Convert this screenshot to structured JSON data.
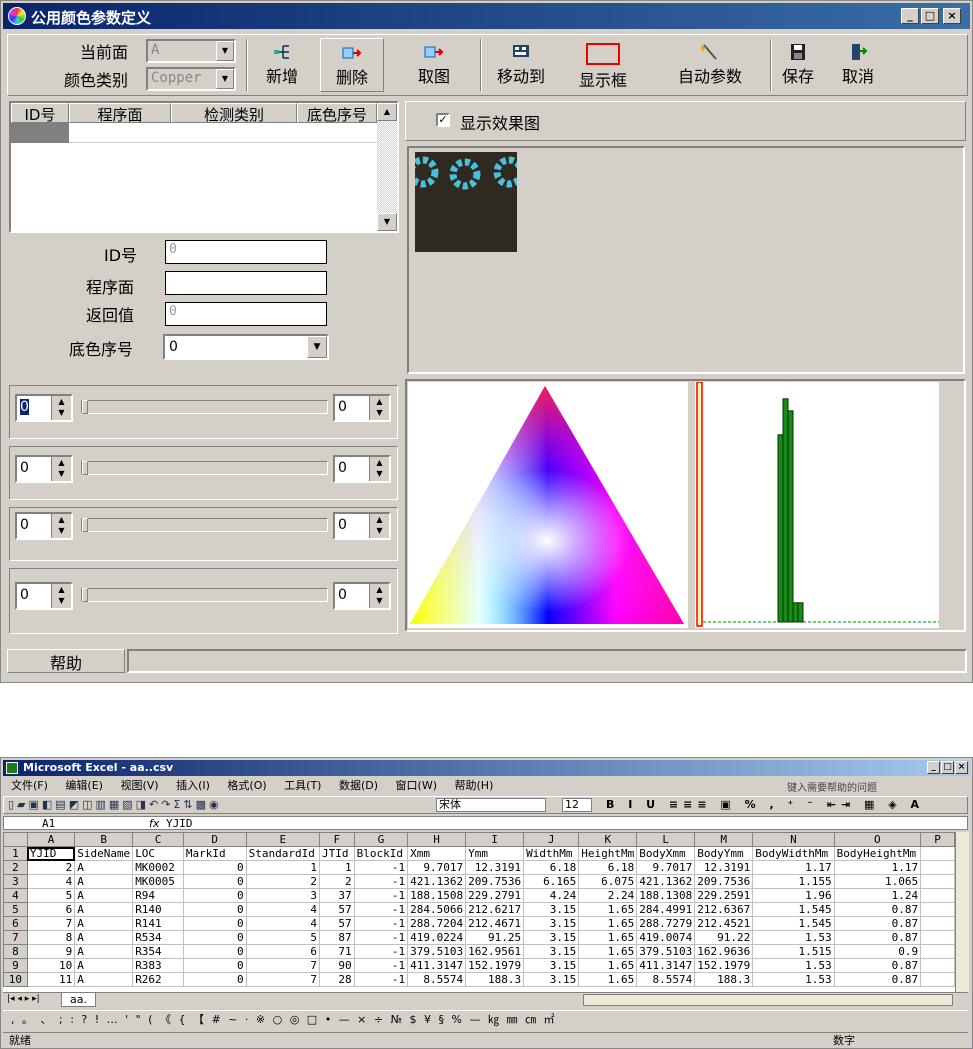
{
  "window": {
    "title": "公用颜色参数定义",
    "min": "_",
    "max": "□",
    "close": "×"
  },
  "toolbar": {
    "current_face_label": "当前面",
    "current_face_value": "A",
    "color_category_label": "颜色类别",
    "color_category_value": "Copper",
    "buttons": [
      "新增",
      "删除",
      "取图",
      "移动到",
      "显示框",
      "自动参数",
      "保存",
      "取消"
    ]
  },
  "table": {
    "headers": [
      "ID号",
      "程序面",
      "检测类别",
      "底色序号"
    ]
  },
  "form": {
    "id_label": "ID号",
    "id_value": "0",
    "program_face_label": "程序面",
    "program_face_value": "",
    "return_label": "返回值",
    "return_value": "0",
    "base_color_label": "底色序号",
    "base_color_value": "0"
  },
  "preview": {
    "checkbox_label": "显示效果图",
    "checked": true
  },
  "sliders": [
    {
      "left": "0",
      "right": "0"
    },
    {
      "left": "0",
      "right": "0"
    },
    {
      "left": "0",
      "right": "0"
    },
    {
      "left": "0",
      "right": "0"
    }
  ],
  "status": {
    "help": "帮助"
  },
  "histogram": {
    "bars": [
      0.78,
      0.93,
      0.88,
      0.08,
      0.08
    ]
  },
  "excel": {
    "title": "Microsoft Excel - aa..csv",
    "menus": [
      "文件(F)",
      "编辑(E)",
      "视图(V)",
      "插入(I)",
      "格式(O)",
      "工具(T)",
      "数据(D)",
      "窗口(W)",
      "帮助(H)"
    ],
    "help_placeholder": "键入需要帮助的问题",
    "font_name": "宋体",
    "font_size": "12",
    "cell_ref": "A1",
    "formula": "YJID",
    "columns": [
      "A",
      "B",
      "C",
      "D",
      "E",
      "F",
      "G",
      "H",
      "I",
      "J",
      "K",
      "L",
      "M",
      "N",
      "O",
      "P"
    ],
    "rows": [
      [
        "1",
        "YJID",
        "SideName",
        "LOC",
        "MarkId",
        "StandardId",
        "JTId",
        "BlockId",
        "Xmm",
        "Ymm",
        "WidthMm",
        "HeightMm",
        "BodyXmm",
        "BodyYmm",
        "BodyWidthMm",
        "BodyHeightMm",
        ""
      ],
      [
        "2",
        "2",
        "A",
        "MK0002",
        "0",
        "1",
        "1",
        "-1",
        "9.7017",
        "12.3191",
        "6.18",
        "6.18",
        "9.7017",
        "12.3191",
        "1.17",
        "1.17",
        ""
      ],
      [
        "3",
        "4",
        "A",
        "MK0005",
        "0",
        "2",
        "2",
        "-1",
        "421.1362",
        "209.7536",
        "6.165",
        "6.075",
        "421.1362",
        "209.7536",
        "1.155",
        "1.065",
        ""
      ],
      [
        "4",
        "5",
        "A",
        "R94",
        "0",
        "3",
        "37",
        "-1",
        "188.1508",
        "229.2791",
        "4.24",
        "2.24",
        "188.1308",
        "229.2591",
        "1.96",
        "1.24",
        ""
      ],
      [
        "5",
        "6",
        "A",
        "R140",
        "0",
        "4",
        "57",
        "-1",
        "284.5066",
        "212.6217",
        "3.15",
        "1.65",
        "284.4991",
        "212.6367",
        "1.545",
        "0.87",
        ""
      ],
      [
        "6",
        "7",
        "A",
        "R141",
        "0",
        "4",
        "57",
        "-1",
        "288.7204",
        "212.4671",
        "3.15",
        "1.65",
        "288.7279",
        "212.4521",
        "1.545",
        "0.87",
        ""
      ],
      [
        "7",
        "8",
        "A",
        "R534",
        "0",
        "5",
        "87",
        "-1",
        "419.0224",
        "91.25",
        "3.15",
        "1.65",
        "419.0074",
        "91.22",
        "1.53",
        "0.87",
        ""
      ],
      [
        "8",
        "9",
        "A",
        "R354",
        "0",
        "6",
        "71",
        "-1",
        "379.5103",
        "162.9561",
        "3.15",
        "1.65",
        "379.5103",
        "162.9636",
        "1.515",
        "0.9",
        ""
      ],
      [
        "9",
        "10",
        "A",
        "R383",
        "0",
        "7",
        "90",
        "-1",
        "411.3147",
        "152.1979",
        "3.15",
        "1.65",
        "411.3147",
        "152.1979",
        "1.53",
        "0.87",
        ""
      ],
      [
        "10",
        "11",
        "A",
        "R262",
        "0",
        "7",
        "28",
        "-1",
        "8.5574",
        "188.3",
        "3.15",
        "1.65",
        "8.5574",
        "188.3",
        "1.53",
        "0.87",
        ""
      ]
    ],
    "sheet_tab": "aa.",
    "status_left": "就绪",
    "status_right": "数字",
    "symbols": ", 。 、 ; : ? ! … ' \" ( 《 { 【 # ~ · ※ ○ ◎ □ • — × ÷ № $ ¥ § % — ㎏ ㎜ ㎝ ㎡"
  }
}
